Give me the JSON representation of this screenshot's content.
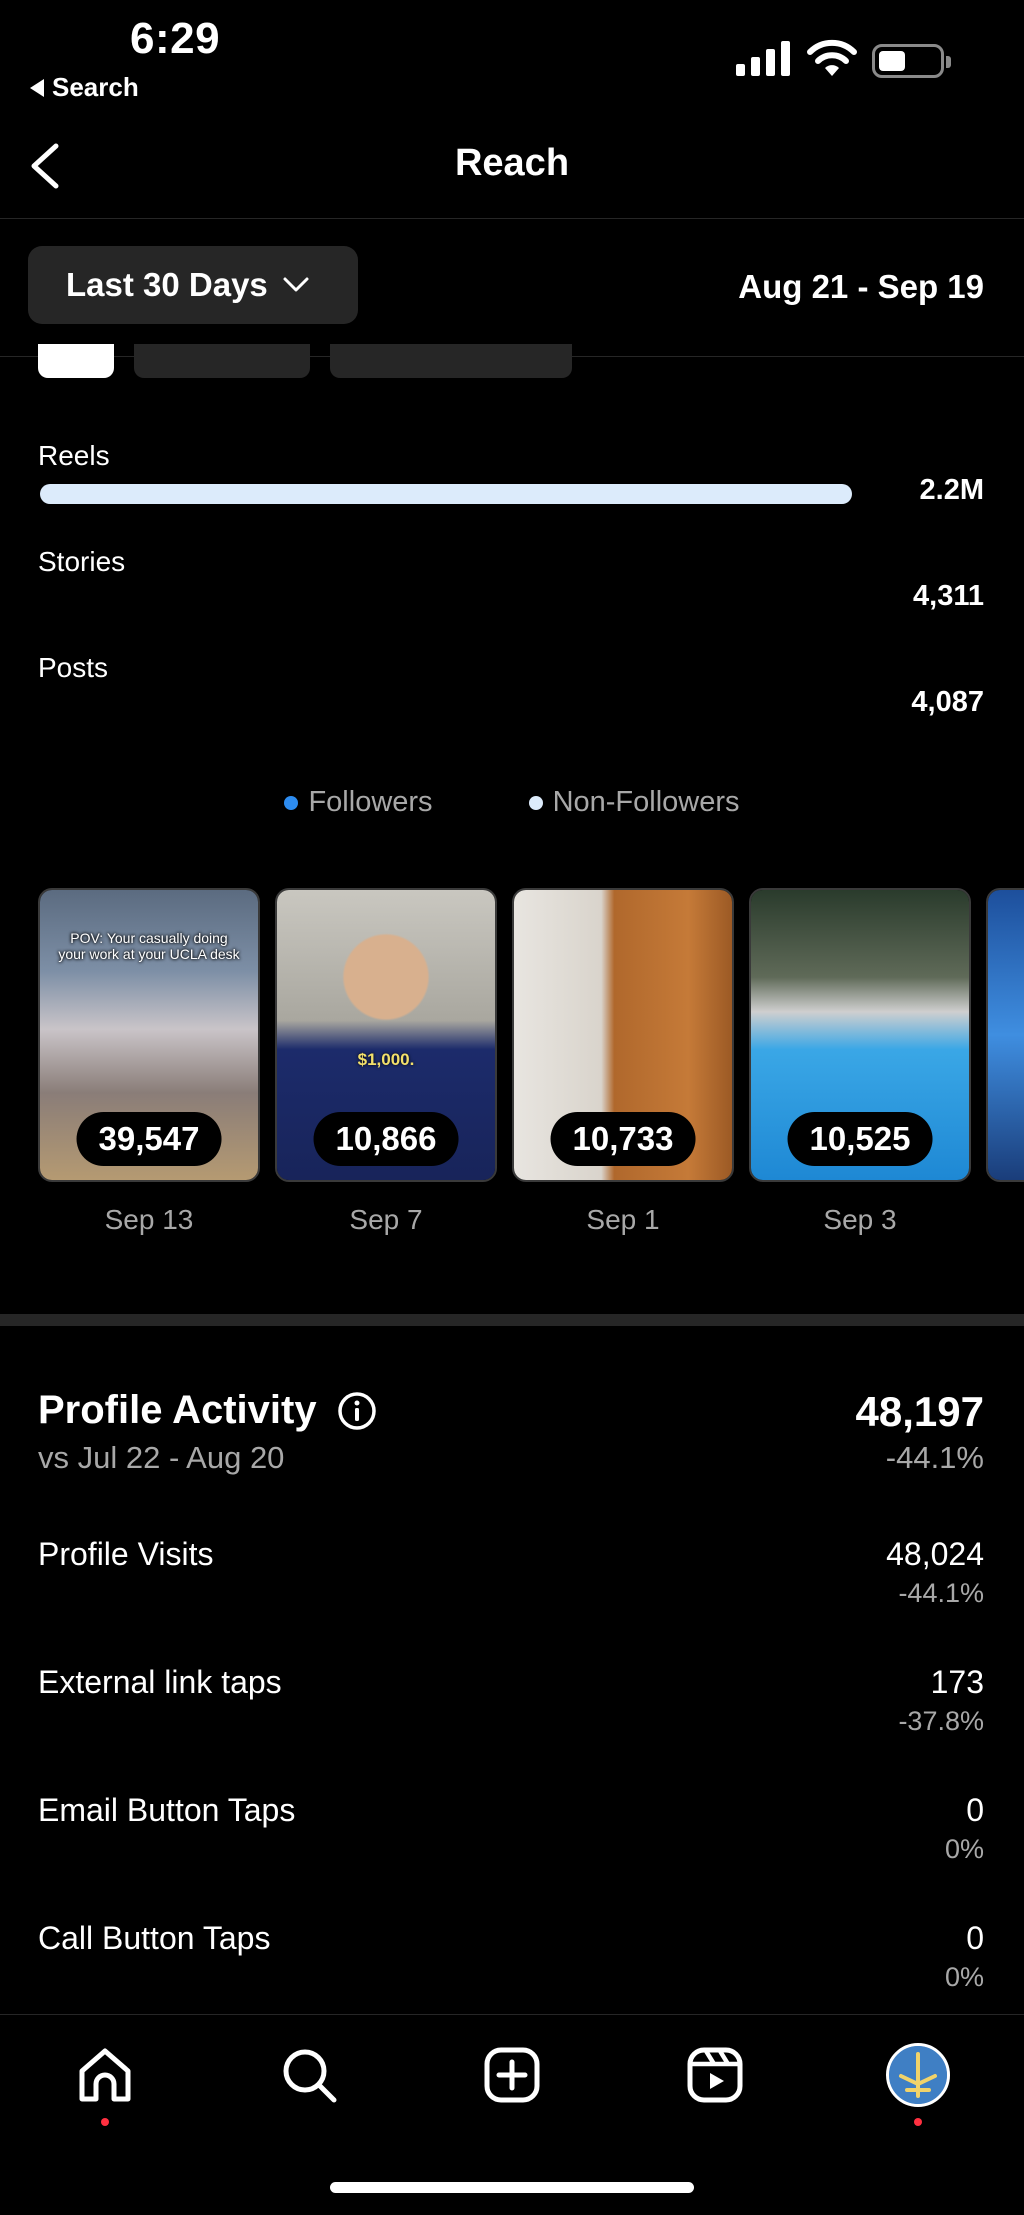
{
  "status_bar": {
    "time": "6:29",
    "back_label": "Search"
  },
  "header": {
    "title": "Reach"
  },
  "range": {
    "label": "Last 30 Days",
    "dates": "Aug 21 - Sep 19"
  },
  "content_types": [
    {
      "label": "Reels",
      "value": "2.2M",
      "fraction": 1.0
    },
    {
      "label": "Stories",
      "value": "4,311",
      "fraction": 0.002
    },
    {
      "label": "Posts",
      "value": "4,087",
      "fraction": 0.002
    }
  ],
  "legend": [
    {
      "label": "Followers",
      "color": "#2d8cf0"
    },
    {
      "label": "Non-Followers",
      "color": "#dcebfb"
    }
  ],
  "top_content": [
    {
      "count": "39,547",
      "date": "Sep 13",
      "caption": "POV: Your casually doing your work at your UCLA desk"
    },
    {
      "count": "10,866",
      "date": "Sep 7",
      "caption": "$1,000."
    },
    {
      "count": "10,733",
      "date": "Sep 1"
    },
    {
      "count": "10,525",
      "date": "Sep 3"
    }
  ],
  "profile_activity": {
    "title": "Profile Activity",
    "compare": "vs Jul 22 - Aug 20",
    "total": "48,197",
    "total_change": "-44.1%",
    "metrics": [
      {
        "label": "Profile Visits",
        "value": "48,024",
        "change": "-44.1%"
      },
      {
        "label": "External link taps",
        "value": "173",
        "change": "-37.8%"
      },
      {
        "label": "Email Button Taps",
        "value": "0",
        "change": "0%"
      },
      {
        "label": "Call Button Taps",
        "value": "0",
        "change": "0%"
      }
    ]
  },
  "nav": [
    "home-icon",
    "search-icon",
    "create-icon",
    "reels-icon",
    "profile-avatar"
  ]
}
